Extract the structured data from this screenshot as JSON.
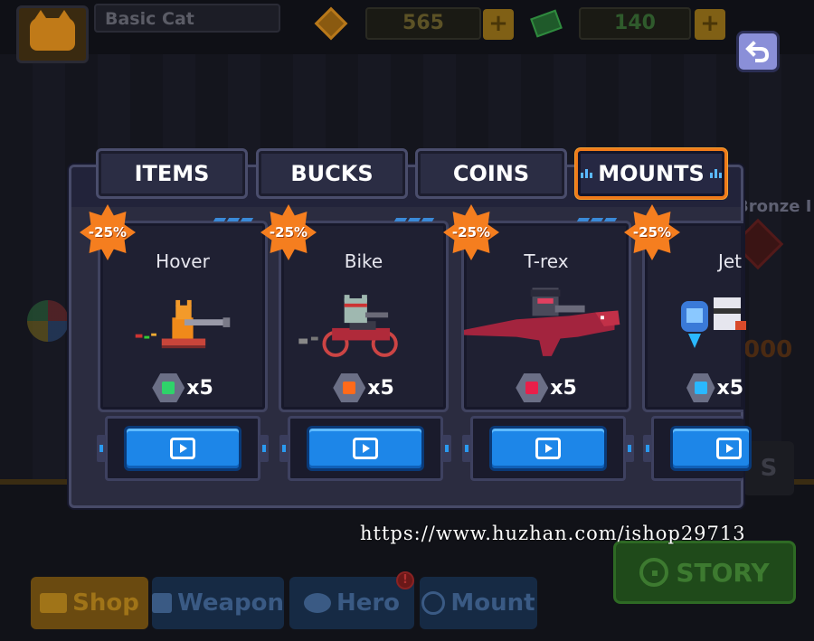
{
  "hud": {
    "player_name": "Basic Cat",
    "gold_amount": "565",
    "cash_amount": "140",
    "plus_label": "+",
    "back_icon": "undo-arrow-icon"
  },
  "background": {
    "rank_label": "Bronze I",
    "score_fragment": "000",
    "button_fragment": "S",
    "story_label": "STORY"
  },
  "bottom_nav": [
    {
      "label": "Shop",
      "icon": "cart-icon"
    },
    {
      "label": "Weapon",
      "icon": "weapon-icon"
    },
    {
      "label": "Hero",
      "icon": "hero-icon"
    },
    {
      "label": "Mount",
      "icon": "mount-icon"
    }
  ],
  "hero_alert": "!",
  "shop": {
    "tabs": [
      {
        "label": "ITEMS",
        "active": false
      },
      {
        "label": "BUCKS",
        "active": false
      },
      {
        "label": "COINS",
        "active": false
      },
      {
        "label": "MOUNTS",
        "active": true
      }
    ],
    "cards": [
      {
        "name": "Hover",
        "discount": "-25%",
        "gem_color": "#2fd36a",
        "quantity": "x5",
        "art": "hoverboard-cat-icon"
      },
      {
        "name": "Bike",
        "discount": "-25%",
        "gem_color": "#ff6a1a",
        "quantity": "x5",
        "art": "motorbike-cat-icon"
      },
      {
        "name": "T-rex",
        "discount": "-25%",
        "gem_color": "#e8204a",
        "quantity": "x5",
        "art": "trex-rider-icon"
      },
      {
        "name": "Jet",
        "discount": "-25%",
        "gem_color": "#2ab8ff",
        "quantity": "x5",
        "art": "jetpack-cat-icon"
      }
    ]
  },
  "watermark": "https://www.huzhan.com/ishop29713",
  "colors": {
    "accent_orange": "#f07a1a",
    "video_blue": "#1d86e8",
    "panel": "#2b2c40"
  }
}
